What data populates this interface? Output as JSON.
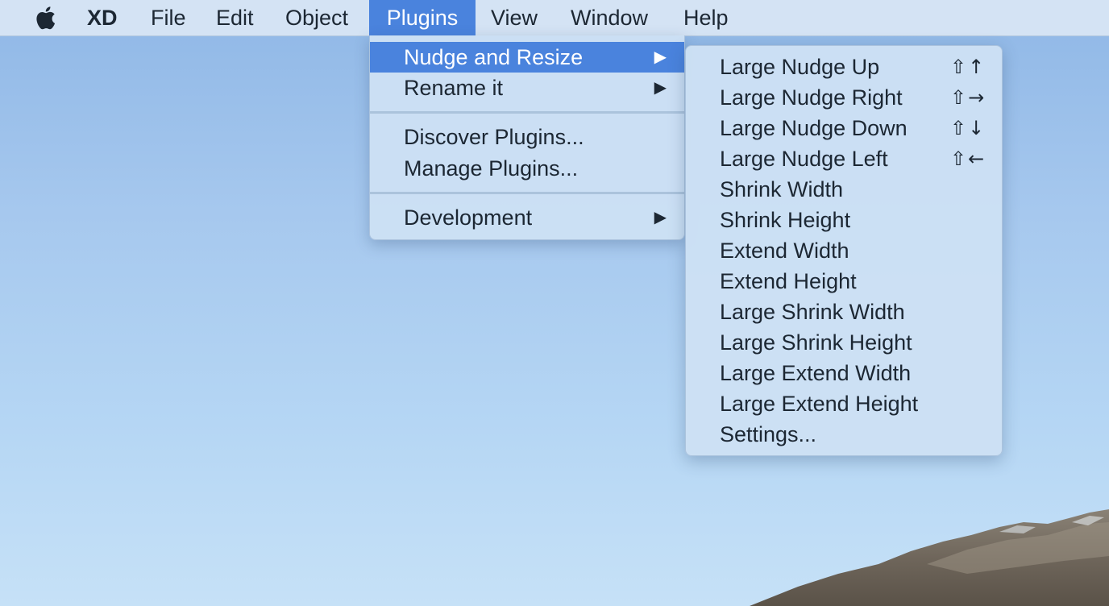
{
  "menubar": {
    "app_name": "XD",
    "items": [
      "File",
      "Edit",
      "Object",
      "Plugins",
      "View",
      "Window",
      "Help"
    ]
  },
  "plugins_menu": {
    "items": [
      {
        "label": "Nudge and Resize",
        "has_submenu": true,
        "highlighted": true
      },
      {
        "label": "Rename it",
        "has_submenu": true
      },
      {
        "label": "Discover Plugins..."
      },
      {
        "label": "Manage Plugins..."
      },
      {
        "label": "Development",
        "has_submenu": true
      }
    ],
    "submenu_arrow": "▶"
  },
  "submenu": {
    "items": [
      {
        "label": "Large Nudge Up",
        "shortcut": "⇧↑"
      },
      {
        "label": "Large Nudge Right",
        "shortcut": "⇧→"
      },
      {
        "label": "Large Nudge Down",
        "shortcut": "⇧↓"
      },
      {
        "label": "Large Nudge Left",
        "shortcut": "⇧←"
      },
      {
        "label": "Shrink Width"
      },
      {
        "label": "Shrink Height"
      },
      {
        "label": "Extend Width"
      },
      {
        "label": "Extend Height"
      },
      {
        "label": "Large Shrink Width"
      },
      {
        "label": "Large Shrink Height"
      },
      {
        "label": "Large Extend Width"
      },
      {
        "label": "Large Extend Height"
      },
      {
        "label": "Settings..."
      }
    ]
  },
  "colors": {
    "highlight": "#4a83dd",
    "menu_bg": "#cce0f4",
    "text": "#1c2733"
  },
  "icons": {
    "apple": "apple-logo-icon",
    "submenu": "chevron-right-icon"
  }
}
